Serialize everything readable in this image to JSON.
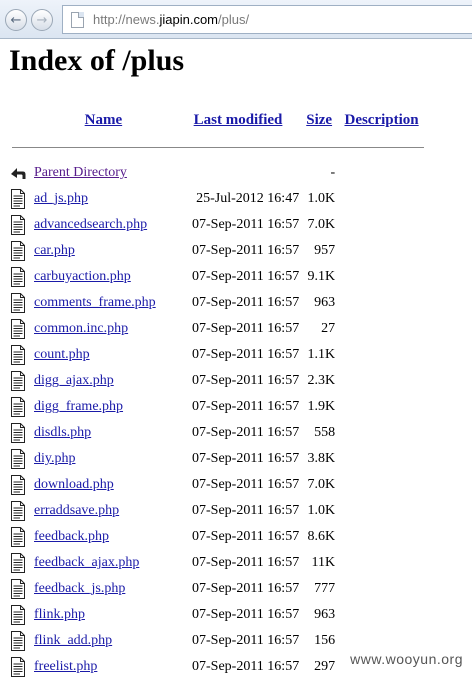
{
  "browser": {
    "back_icon": "arrow-left",
    "forward_icon": "arrow-right",
    "url_prefix": "http://news.",
    "url_host": "jiapin.com",
    "url_path": "/plus/"
  },
  "page": {
    "title": "Index of /plus",
    "columns": {
      "name": "Name",
      "last_modified": "Last modified",
      "size": "Size",
      "description": "Description"
    },
    "parent": {
      "name": "Parent Directory",
      "size": "-"
    },
    "files": [
      {
        "name": "ad_js.php",
        "date": "25-Jul-2012 16:47",
        "size": "1.0K"
      },
      {
        "name": "advancedsearch.php",
        "date": "07-Sep-2011 16:57",
        "size": "7.0K"
      },
      {
        "name": "car.php",
        "date": "07-Sep-2011 16:57",
        "size": "957"
      },
      {
        "name": "carbuyaction.php",
        "date": "07-Sep-2011 16:57",
        "size": "9.1K"
      },
      {
        "name": "comments_frame.php",
        "date": "07-Sep-2011 16:57",
        "size": "963"
      },
      {
        "name": "common.inc.php",
        "date": "07-Sep-2011 16:57",
        "size": "27"
      },
      {
        "name": "count.php",
        "date": "07-Sep-2011 16:57",
        "size": "1.1K"
      },
      {
        "name": "digg_ajax.php",
        "date": "07-Sep-2011 16:57",
        "size": "2.3K"
      },
      {
        "name": "digg_frame.php",
        "date": "07-Sep-2011 16:57",
        "size": "1.9K"
      },
      {
        "name": "disdls.php",
        "date": "07-Sep-2011 16:57",
        "size": "558"
      },
      {
        "name": "diy.php",
        "date": "07-Sep-2011 16:57",
        "size": "3.8K"
      },
      {
        "name": "download.php",
        "date": "07-Sep-2011 16:57",
        "size": "7.0K"
      },
      {
        "name": "erraddsave.php",
        "date": "07-Sep-2011 16:57",
        "size": "1.0K"
      },
      {
        "name": "feedback.php",
        "date": "07-Sep-2011 16:57",
        "size": "8.6K"
      },
      {
        "name": "feedback_ajax.php",
        "date": "07-Sep-2011 16:57",
        "size": "11K"
      },
      {
        "name": "feedback_js.php",
        "date": "07-Sep-2011 16:57",
        "size": "777"
      },
      {
        "name": "flink.php",
        "date": "07-Sep-2011 16:57",
        "size": "963"
      },
      {
        "name": "flink_add.php",
        "date": "07-Sep-2011 16:57",
        "size": "156"
      },
      {
        "name": "freelist.php",
        "date": "07-Sep-2011 16:57",
        "size": "297"
      }
    ]
  },
  "watermark": "www.wooyun.org"
}
